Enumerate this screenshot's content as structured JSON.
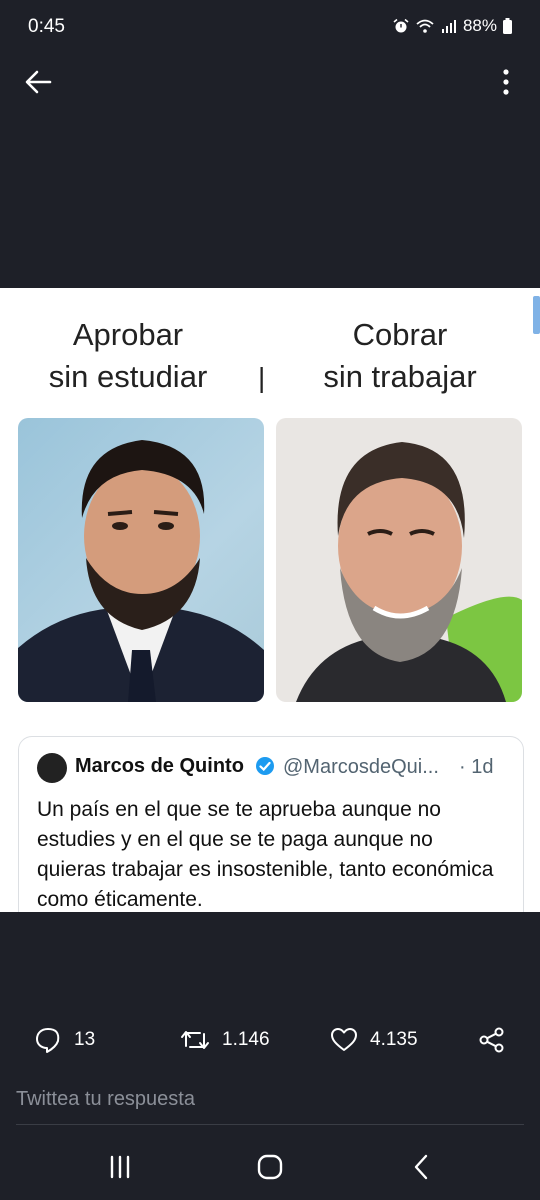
{
  "status": {
    "time": "0:45",
    "battery": "88%"
  },
  "media": {
    "caption_left": [
      "Aprobar",
      "sin estudiar"
    ],
    "separator": "|",
    "caption_right": [
      "Cobrar",
      "sin trabajar"
    ]
  },
  "quoted_tweet": {
    "name": "Marcos de Quinto",
    "handle": "@MarcosdeQui...",
    "time": "· 1d",
    "text": "Un país en el que se te aprueba aunque no estudies y en el que se te paga aunque no quieras trabajar es insostenible, tanto económica como éticamente."
  },
  "actions": {
    "replies": "13",
    "retweets": "1.146",
    "likes": "4.135"
  },
  "reply": {
    "placeholder": "Twittea tu respuesta"
  },
  "colors": {
    "background": "#1e2028",
    "verified": "#1d9bf0"
  }
}
